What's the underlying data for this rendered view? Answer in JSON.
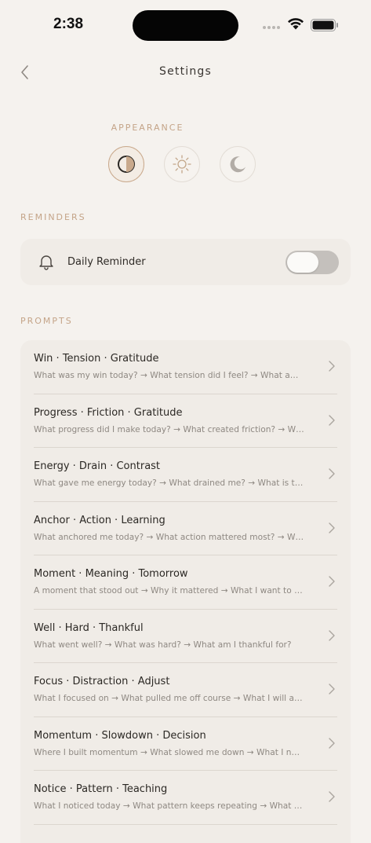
{
  "status_bar": {
    "time": "2:38"
  },
  "nav": {
    "title": "Settings"
  },
  "appearance": {
    "label": "APPEARANCE",
    "options": [
      {
        "icon": "half-circle-icon",
        "selected": true
      },
      {
        "icon": "sun-icon",
        "selected": false
      },
      {
        "icon": "moon-icon",
        "selected": false
      }
    ]
  },
  "reminders": {
    "label": "REMINDERS",
    "daily_reminder": {
      "label": "Daily Reminder",
      "enabled": false
    }
  },
  "prompts": {
    "label": "PROMPTS",
    "items": [
      {
        "title": "Win · Tension · Gratitude",
        "subtitle": "What was my win today? → What tension did I feel? → What am I..."
      },
      {
        "title": "Progress · Friction · Gratitude",
        "subtitle": "What progress did I make today? → What created friction? → Wh..."
      },
      {
        "title": "Energy · Drain · Contrast",
        "subtitle": "What gave me energy today? → What drained me? → What is tha..."
      },
      {
        "title": "Anchor · Action · Learning",
        "subtitle": "What anchored me today? → What action mattered most? → Wh..."
      },
      {
        "title": "Moment · Meaning · Tomorrow",
        "subtitle": "A moment that stood out → Why it mattered → What I want to do..."
      },
      {
        "title": "Well · Hard · Thankful",
        "subtitle": "What went well? → What was hard? → What am I thankful for?"
      },
      {
        "title": "Focus · Distraction · Adjust",
        "subtitle": "What I focused on → What pulled me off course → What I will adj..."
      },
      {
        "title": "Momentum · Slowdown · Decision",
        "subtitle": "Where I built momentum → What slowed me down → What I nee..."
      },
      {
        "title": "Notice · Pattern · Teaching",
        "subtitle": "What I noticed today → What pattern keeps repeating → What it is..."
      }
    ]
  },
  "colors": {
    "accent": "#c4a488",
    "background": "#f5f2ee",
    "card": "#f0ece7"
  }
}
